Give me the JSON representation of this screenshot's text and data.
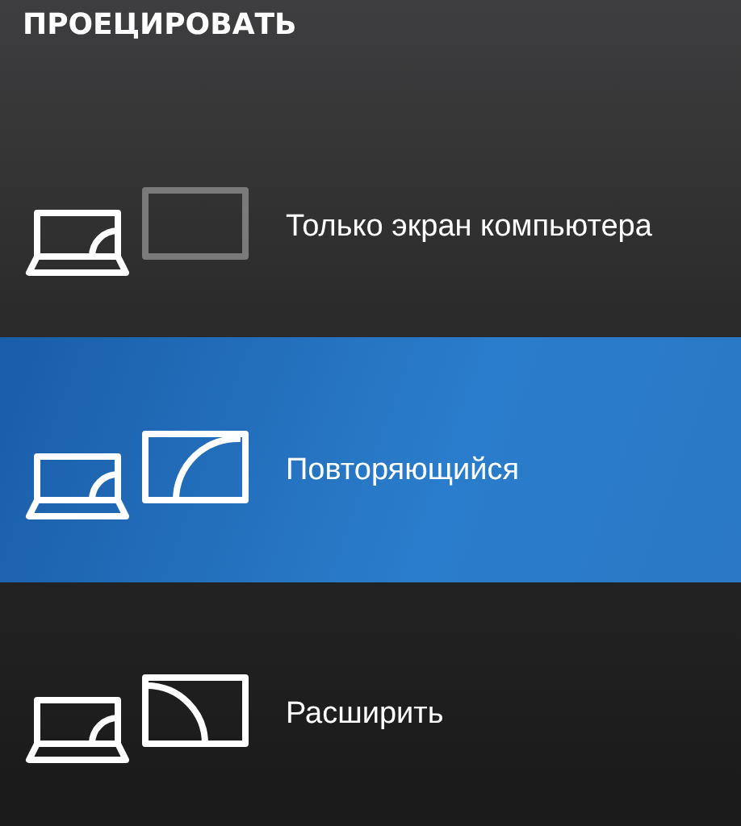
{
  "title": "ПРОЕЦИРОВАТЬ",
  "options": [
    {
      "kind": "pc_only",
      "label": "Только экран компьютера",
      "selected": false
    },
    {
      "kind": "duplicate",
      "label": "Повторяющийся",
      "selected": true
    },
    {
      "kind": "extend",
      "label": "Расширить",
      "selected": false
    }
  ]
}
